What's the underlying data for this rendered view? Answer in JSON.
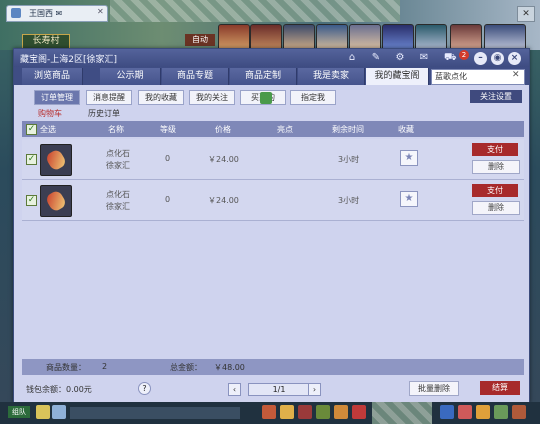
{
  "browser": {
    "tab_title": "王国西 ✉",
    "close": "✕"
  },
  "game": {
    "location": "长寿村",
    "auto": "自动"
  },
  "window": {
    "title": "藏宝阁-上海2区[徐家汇]",
    "cart_count": "2",
    "controls": {
      "minimize": "–",
      "restore": "◉",
      "close": "×"
    }
  },
  "main_tabs": [
    "浏览商品",
    "公示期",
    "商品专题",
    "商品定制",
    "我是卖家",
    "我的藏宝阁"
  ],
  "search": {
    "value": "蓝歌点化",
    "clear": "✕"
  },
  "sub_tabs": [
    "订单管理",
    "消息提醒",
    "我的收藏",
    "我的关注",
    "买到的",
    "指定我"
  ],
  "settings_button": "关注设置",
  "links": {
    "cart": "购物车",
    "history": "历史订单"
  },
  "table": {
    "select_all": "全选",
    "headers": [
      "名称",
      "等级",
      "价格",
      "亮点",
      "剩余时间",
      "收藏"
    ],
    "rows": [
      {
        "name": "点化石",
        "server": "徐家汇",
        "level": "0",
        "price": "￥24.00",
        "time": "3小时",
        "pay": "支付",
        "delete": "删除"
      },
      {
        "name": "点化石",
        "server": "徐家汇",
        "level": "0",
        "price": "￥24.00",
        "time": "3小时",
        "pay": "支付",
        "delete": "删除"
      }
    ]
  },
  "summary": {
    "count_label": "商品数量：",
    "count": "2",
    "total_label": "总金额：",
    "total": "￥48.00"
  },
  "footer": {
    "wallet_label": "钱包余额：0.00元",
    "help": "?",
    "page": "1/1",
    "prev": "‹",
    "next": "›",
    "batch_delete": "批量删除",
    "checkout": "结算"
  },
  "bottombar": {
    "start": "组队"
  },
  "colors": {
    "accent": "#a72a2b",
    "frame": "#3f4d84",
    "panel": "#cfd3ee"
  }
}
